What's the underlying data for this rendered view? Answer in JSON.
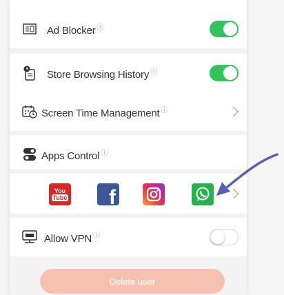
{
  "settings": {
    "ad_blocker": {
      "label": "Ad Blocker",
      "info": "ⓘ",
      "enabled": true
    },
    "store_history": {
      "label": "Store Browsing History",
      "info": "ⓘ",
      "enabled": true
    },
    "screen_time": {
      "label": "Screen Time Management",
      "info": "ⓘ"
    },
    "apps_control": {
      "label": "Apps Control",
      "info": "ⓘ"
    },
    "allow_vpn": {
      "label": "Allow VPN",
      "info": "ⓘ",
      "enabled": false
    }
  },
  "apps": [
    {
      "name": "YouTube",
      "logo_text_1": "You",
      "logo_text_2": "Tube",
      "color": "#d52a24"
    },
    {
      "name": "Facebook",
      "logo_text": "f",
      "color": "#3b5998"
    },
    {
      "name": "Instagram",
      "color": "#d6249f"
    },
    {
      "name": "WhatsApp",
      "color": "#25b14b"
    }
  ],
  "actions": {
    "delete_user": "Delete user"
  },
  "colors": {
    "accent": "#f07a5c",
    "toggle_on": "#34c25a",
    "arrow": "#5a5fb0"
  }
}
